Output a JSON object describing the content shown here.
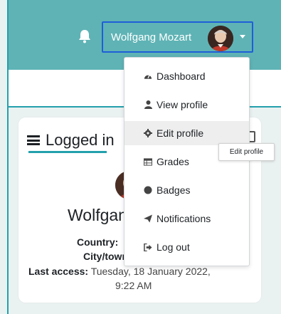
{
  "navbar": {
    "user_name": "Wolfgang Mozart",
    "accent": "#5fb3b5",
    "border": "#23a0ac",
    "focus_outline": "#1e5fd8",
    "bell_icon": "bell-icon"
  },
  "user_menu": {
    "items": [
      {
        "label": "Dashboard",
        "icon": "tachometer-icon"
      },
      {
        "label": "View profile",
        "icon": "user-icon"
      },
      {
        "label": "Edit profile",
        "icon": "cog-icon"
      },
      {
        "label": "Grades",
        "icon": "table-icon"
      },
      {
        "label": "Badges",
        "icon": "badge-icon"
      },
      {
        "label": "Notifications",
        "icon": "paper-plane-icon"
      },
      {
        "label": "Log out",
        "icon": "sign-out-icon"
      }
    ],
    "hovered": "Edit profile",
    "tooltip": "Edit profile"
  },
  "card": {
    "title": "Logged in",
    "name": "Wolfgang Mozart",
    "country_label": "Country:",
    "city_label": "City/town:",
    "last_access_label": "Last access:",
    "last_access_value_line1": "Tuesday, 18 January 2022,",
    "last_access_value_line2": "9:22 AM"
  }
}
